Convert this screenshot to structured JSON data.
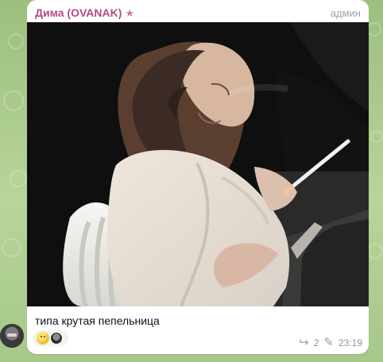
{
  "message": {
    "sender_name": "Дима (OVANAK)",
    "role": "админ",
    "caption": "типа крутая пепельница",
    "forward_count": "2",
    "time": "23:19"
  },
  "icons": {
    "star": "star-icon",
    "forward": "forward-icon",
    "edit": "edit-icon"
  },
  "colors": {
    "sender": "#b14d83",
    "bubble": "#ffffff",
    "chat_background": "#a9c88b"
  }
}
